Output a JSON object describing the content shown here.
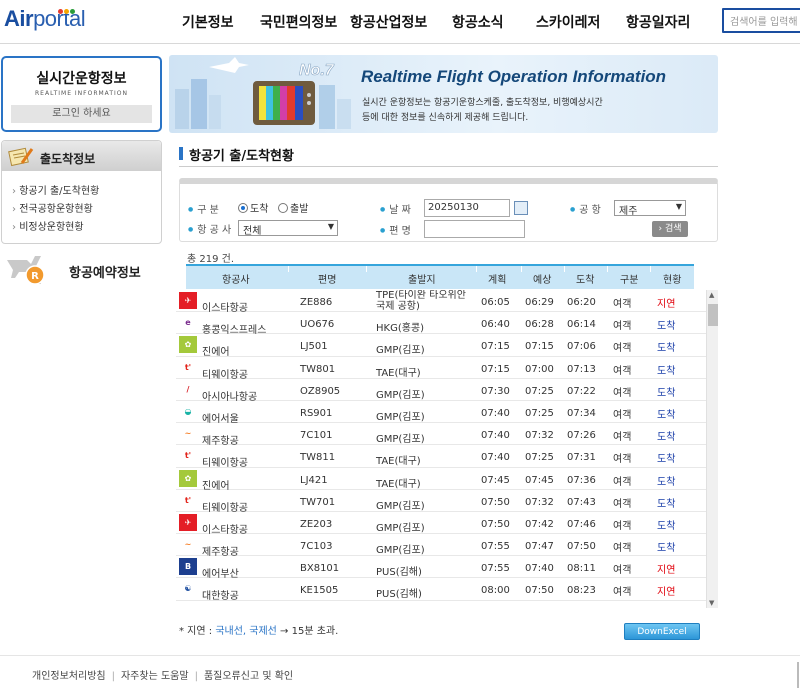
{
  "header": {
    "logo_main": "Air",
    "logo_sub": "portal",
    "nav": [
      "기본정보",
      "국민편의정보",
      "항공산업정보",
      "항공소식",
      "스카이레저",
      "항공일자리"
    ],
    "search_placeholder": "검색어를 입력해"
  },
  "sidebar": {
    "realtime_title": "실시간운항정보",
    "realtime_sub": "REALTIME INFORMATION",
    "login_label": "로그인 하세요",
    "arr_title": "출도착정보",
    "arr_items": [
      "항공기 출/도착현황",
      "전국공항운항현황",
      "비정상운항현황"
    ],
    "resv_title": "항공예약정보"
  },
  "banner": {
    "title": "Realtime Flight Operation Information",
    "line1": "실시간 운항정보는 항공기운항스케줄, 출도착정보, 비행예상시간",
    "line2": "등에 대한 정보를 신속하게 제공해 드립니다."
  },
  "section_title": "항공기 출/도착현황",
  "form": {
    "type_label": "구    분",
    "radio_arrival": "도착",
    "radio_departure": "출발",
    "date_label": "날    짜",
    "date_value": "20250130",
    "airport_label": "공  항",
    "airport_value": "제주",
    "airline_label": "항 공 사",
    "airline_value": "전체",
    "flight_label": "편    명",
    "flight_value": "",
    "search_button": "검색"
  },
  "total": "총 219 건.",
  "table": {
    "headers": [
      "항공사",
      "편명",
      "출발지",
      "계획",
      "예상",
      "도착",
      "구분",
      "현황"
    ],
    "rows": [
      {
        "airline": "이스타항공",
        "logo": "eastar",
        "flight": "ZE886",
        "dep": "TPE(타이완 타오위안 국제 공항)",
        "plan": "06:05",
        "exp": "06:29",
        "arr": "06:20",
        "type": "여객",
        "status": "지연",
        "delay": true
      },
      {
        "airline": "홍콩익스프레스",
        "logo": "hkexpress",
        "flight": "UO676",
        "dep": "HKG(홍콩)",
        "plan": "06:40",
        "exp": "06:28",
        "arr": "06:14",
        "type": "여객",
        "status": "도착",
        "delay": false
      },
      {
        "airline": "진에어",
        "logo": "jinair",
        "flight": "LJ501",
        "dep": "GMP(김포)",
        "plan": "07:15",
        "exp": "07:15",
        "arr": "07:06",
        "type": "여객",
        "status": "도착",
        "delay": false
      },
      {
        "airline": "티웨이항공",
        "logo": "tway",
        "flight": "TW801",
        "dep": "TAE(대구)",
        "plan": "07:15",
        "exp": "07:00",
        "arr": "07:13",
        "type": "여객",
        "status": "도착",
        "delay": false
      },
      {
        "airline": "아시아나항공",
        "logo": "asiana",
        "flight": "OZ8905",
        "dep": "GMP(김포)",
        "plan": "07:30",
        "exp": "07:25",
        "arr": "07:22",
        "type": "여객",
        "status": "도착",
        "delay": false
      },
      {
        "airline": "에어서울",
        "logo": "airseoul",
        "flight": "RS901",
        "dep": "GMP(김포)",
        "plan": "07:40",
        "exp": "07:25",
        "arr": "07:34",
        "type": "여객",
        "status": "도착",
        "delay": false
      },
      {
        "airline": "제주항공",
        "logo": "jejuair",
        "flight": "7C101",
        "dep": "GMP(김포)",
        "plan": "07:40",
        "exp": "07:32",
        "arr": "07:26",
        "type": "여객",
        "status": "도착",
        "delay": false
      },
      {
        "airline": "티웨이항공",
        "logo": "tway",
        "flight": "TW811",
        "dep": "TAE(대구)",
        "plan": "07:40",
        "exp": "07:25",
        "arr": "07:31",
        "type": "여객",
        "status": "도착",
        "delay": false
      },
      {
        "airline": "진에어",
        "logo": "jinair",
        "flight": "LJ421",
        "dep": "TAE(대구)",
        "plan": "07:45",
        "exp": "07:45",
        "arr": "07:36",
        "type": "여객",
        "status": "도착",
        "delay": false
      },
      {
        "airline": "티웨이항공",
        "logo": "tway",
        "flight": "TW701",
        "dep": "GMP(김포)",
        "plan": "07:50",
        "exp": "07:32",
        "arr": "07:43",
        "type": "여객",
        "status": "도착",
        "delay": false
      },
      {
        "airline": "이스타항공",
        "logo": "eastar",
        "flight": "ZE203",
        "dep": "GMP(김포)",
        "plan": "07:50",
        "exp": "07:42",
        "arr": "07:46",
        "type": "여객",
        "status": "도착",
        "delay": false
      },
      {
        "airline": "제주항공",
        "logo": "jejuair",
        "flight": "7C103",
        "dep": "GMP(김포)",
        "plan": "07:55",
        "exp": "07:47",
        "arr": "07:50",
        "type": "여객",
        "status": "도착",
        "delay": false
      },
      {
        "airline": "에어부산",
        "logo": "airbusan",
        "flight": "BX8101",
        "dep": "PUS(김해)",
        "plan": "07:55",
        "exp": "07:40",
        "arr": "08:11",
        "type": "여객",
        "status": "지연",
        "delay": true
      },
      {
        "airline": "대한항공",
        "logo": "koreanair",
        "flight": "KE1505",
        "dep": "PUS(김해)",
        "plan": "08:00",
        "exp": "07:50",
        "arr": "08:23",
        "type": "여객",
        "status": "지연",
        "delay": true
      }
    ]
  },
  "note": {
    "prefix": "* 지연 : ",
    "hl": "국내선, 국제선",
    "suffix": " → 15분 초과."
  },
  "excel_button": "DownExcel",
  "footer": [
    "개인정보처리방침",
    "자주찾는 도움말",
    "품질오류신고 및 확인"
  ],
  "colors": {
    "brand": "#1a4ea0",
    "accent": "#2a74c6",
    "delay": "#e0000a",
    "arrived": "#1a3ea8"
  }
}
